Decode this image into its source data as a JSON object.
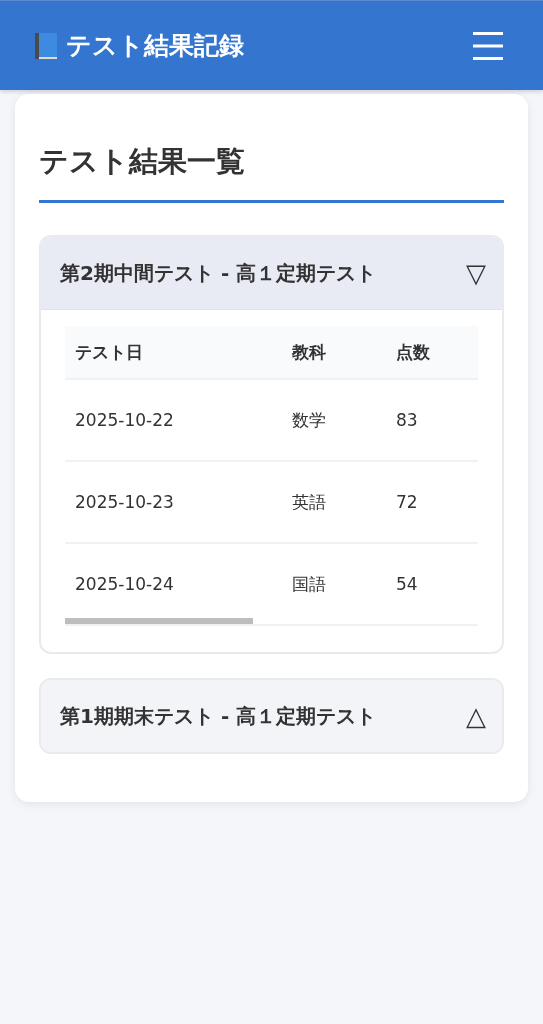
{
  "header": {
    "title": "テスト結果記録"
  },
  "page_title": "テスト結果一覧",
  "groups": [
    {
      "title": "第2期中間テスト - 高１定期テスト",
      "toggle": "▽",
      "expanded": true,
      "table": {
        "columns": [
          "テスト日",
          "教科",
          "点数"
        ],
        "rows": [
          [
            "2025-10-22",
            "数学",
            "83"
          ],
          [
            "2025-10-23",
            "英語",
            "72"
          ],
          [
            "2025-10-24",
            "国語",
            "54"
          ]
        ]
      }
    },
    {
      "title": "第1期期末テスト - 高１定期テスト",
      "toggle": "△",
      "expanded": false
    }
  ]
}
